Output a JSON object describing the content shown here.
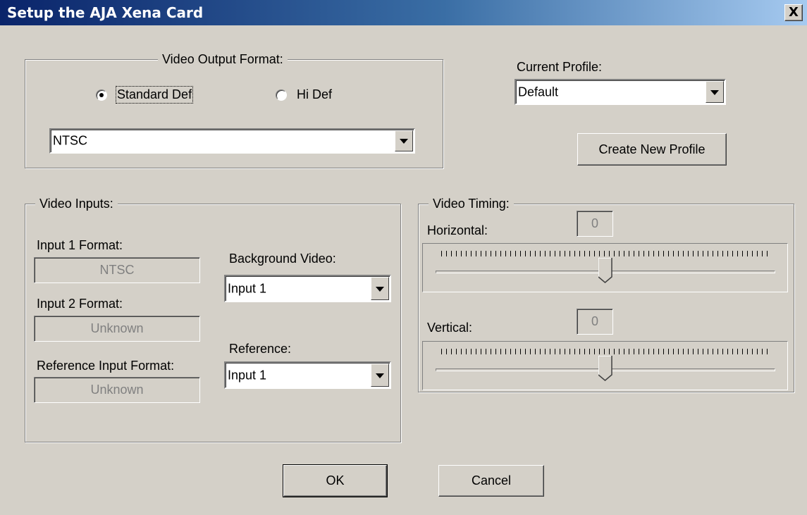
{
  "window": {
    "title": "Setup the AJA Xena Card",
    "close_label": "X"
  },
  "video_output": {
    "legend": "Video Output Format:",
    "radio_standard_label": "Standard Def",
    "radio_hidef_label": "Hi Def",
    "selected": "Standard Def",
    "format_value": "NTSC"
  },
  "profile": {
    "label": "Current Profile:",
    "value": "Default",
    "create_button": "Create New Profile"
  },
  "video_inputs": {
    "legend": "Video Inputs:",
    "input1_label": "Input 1 Format:",
    "input1_value": "NTSC",
    "input2_label": "Input 2 Format:",
    "input2_value": "Unknown",
    "reference_input_label": "Reference Input Format:",
    "reference_input_value": "Unknown",
    "background_label": "Background Video:",
    "background_value": "Input 1",
    "reference_label": "Reference:",
    "reference_value": "Input 1"
  },
  "video_timing": {
    "legend": "Video Timing:",
    "horizontal_label": "Horizontal:",
    "horizontal_value": "0",
    "horizontal_position": 0.5,
    "vertical_label": "Vertical:",
    "vertical_value": "0",
    "vertical_position": 0.5
  },
  "buttons": {
    "ok": "OK",
    "cancel": "Cancel"
  }
}
